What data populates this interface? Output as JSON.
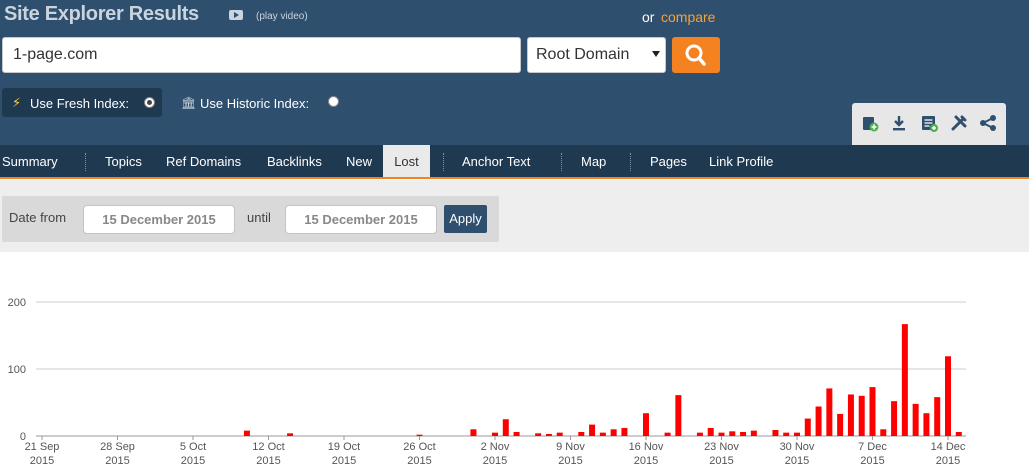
{
  "header": {
    "title": "Site Explorer Results",
    "play_video": "(play video)",
    "or": "or",
    "compare": "compare"
  },
  "search": {
    "value": "1-page.com",
    "scope": "Root Domain"
  },
  "index": {
    "fresh_label": "Use Fresh Index:",
    "historic_label": "Use Historic Index:",
    "selected": "fresh"
  },
  "toolbar": {
    "icons": [
      "add-to-list-icon",
      "download-icon",
      "report-icon",
      "tools-icon",
      "share-icon"
    ]
  },
  "nav": {
    "tabs": [
      "Summary",
      "Topics",
      "Ref Domains",
      "Backlinks",
      "New",
      "Lost",
      "Anchor Text",
      "Map",
      "Pages",
      "Link Profile"
    ],
    "active": "Lost"
  },
  "filter": {
    "date_from_label": "Date from",
    "date_from": "15 December 2015",
    "until_label": "until",
    "date_until": "15 December 2015",
    "apply": "Apply"
  },
  "colors": {
    "header_bg": "#2f4f6e",
    "nav_bg": "#1f3951",
    "accent": "#f58220",
    "compare_link": "#f4a23a",
    "bar": "#ff0000"
  },
  "chart_data": {
    "type": "bar",
    "x_start": "2015-09-21",
    "x_end": "2015-12-15",
    "ylim": [
      0,
      200
    ],
    "yticks": [
      0,
      100,
      200
    ],
    "xtick_labels": [
      [
        "21 Sep",
        "2015"
      ],
      [
        "28 Sep",
        "2015"
      ],
      [
        "5 Oct",
        "2015"
      ],
      [
        "12 Oct",
        "2015"
      ],
      [
        "19 Oct",
        "2015"
      ],
      [
        "26 Oct",
        "2015"
      ],
      [
        "2 Nov",
        "2015"
      ],
      [
        "9 Nov",
        "2015"
      ],
      [
        "16 Nov",
        "2015"
      ],
      [
        "23 Nov",
        "2015"
      ],
      [
        "30 Nov",
        "2015"
      ],
      [
        "7 Dec",
        "2015"
      ],
      [
        "14 Dec",
        "2015"
      ]
    ],
    "grid": true,
    "series": [
      {
        "values": [
          [
            "2015-10-10",
            8
          ],
          [
            "2015-10-14",
            4
          ],
          [
            "2015-10-26",
            2
          ],
          [
            "2015-10-31",
            10
          ],
          [
            "2015-11-02",
            5
          ],
          [
            "2015-11-03",
            25
          ],
          [
            "2015-11-04",
            6
          ],
          [
            "2015-11-06",
            4
          ],
          [
            "2015-11-07",
            3
          ],
          [
            "2015-11-08",
            5
          ],
          [
            "2015-11-10",
            6
          ],
          [
            "2015-11-11",
            17
          ],
          [
            "2015-11-12",
            5
          ],
          [
            "2015-11-13",
            10
          ],
          [
            "2015-11-14",
            12
          ],
          [
            "2015-11-16",
            34
          ],
          [
            "2015-11-18",
            5
          ],
          [
            "2015-11-19",
            61
          ],
          [
            "2015-11-21",
            5
          ],
          [
            "2015-11-22",
            12
          ],
          [
            "2015-11-23",
            5
          ],
          [
            "2015-11-24",
            7
          ],
          [
            "2015-11-25",
            6
          ],
          [
            "2015-11-26",
            8
          ],
          [
            "2015-11-28",
            9
          ],
          [
            "2015-11-29",
            5
          ],
          [
            "2015-11-30",
            5
          ],
          [
            "2015-12-01",
            26
          ],
          [
            "2015-12-02",
            44
          ],
          [
            "2015-12-03",
            71
          ],
          [
            "2015-12-04",
            33
          ],
          [
            "2015-12-05",
            62
          ],
          [
            "2015-12-06",
            60
          ],
          [
            "2015-12-07",
            73
          ],
          [
            "2015-12-08",
            10
          ],
          [
            "2015-12-09",
            52
          ],
          [
            "2015-12-10",
            167
          ],
          [
            "2015-12-11",
            48
          ],
          [
            "2015-12-12",
            34
          ],
          [
            "2015-12-13",
            58
          ],
          [
            "2015-12-14",
            119
          ],
          [
            "2015-12-15",
            6
          ]
        ]
      }
    ]
  }
}
